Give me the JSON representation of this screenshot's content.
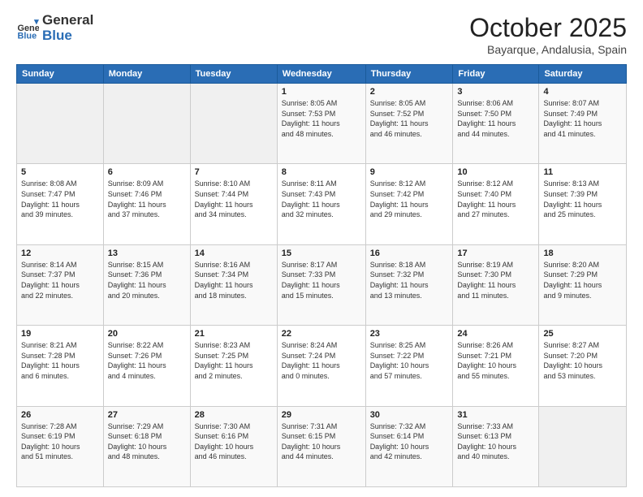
{
  "header": {
    "logo_general": "General",
    "logo_blue": "Blue",
    "month_title": "October 2025",
    "location": "Bayarque, Andalusia, Spain"
  },
  "calendar": {
    "days_of_week": [
      "Sunday",
      "Monday",
      "Tuesday",
      "Wednesday",
      "Thursday",
      "Friday",
      "Saturday"
    ],
    "weeks": [
      [
        {
          "day": "",
          "info": ""
        },
        {
          "day": "",
          "info": ""
        },
        {
          "day": "",
          "info": ""
        },
        {
          "day": "1",
          "info": "Sunrise: 8:05 AM\nSunset: 7:53 PM\nDaylight: 11 hours\nand 48 minutes."
        },
        {
          "day": "2",
          "info": "Sunrise: 8:05 AM\nSunset: 7:52 PM\nDaylight: 11 hours\nand 46 minutes."
        },
        {
          "day": "3",
          "info": "Sunrise: 8:06 AM\nSunset: 7:50 PM\nDaylight: 11 hours\nand 44 minutes."
        },
        {
          "day": "4",
          "info": "Sunrise: 8:07 AM\nSunset: 7:49 PM\nDaylight: 11 hours\nand 41 minutes."
        }
      ],
      [
        {
          "day": "5",
          "info": "Sunrise: 8:08 AM\nSunset: 7:47 PM\nDaylight: 11 hours\nand 39 minutes."
        },
        {
          "day": "6",
          "info": "Sunrise: 8:09 AM\nSunset: 7:46 PM\nDaylight: 11 hours\nand 37 minutes."
        },
        {
          "day": "7",
          "info": "Sunrise: 8:10 AM\nSunset: 7:44 PM\nDaylight: 11 hours\nand 34 minutes."
        },
        {
          "day": "8",
          "info": "Sunrise: 8:11 AM\nSunset: 7:43 PM\nDaylight: 11 hours\nand 32 minutes."
        },
        {
          "day": "9",
          "info": "Sunrise: 8:12 AM\nSunset: 7:42 PM\nDaylight: 11 hours\nand 29 minutes."
        },
        {
          "day": "10",
          "info": "Sunrise: 8:12 AM\nSunset: 7:40 PM\nDaylight: 11 hours\nand 27 minutes."
        },
        {
          "day": "11",
          "info": "Sunrise: 8:13 AM\nSunset: 7:39 PM\nDaylight: 11 hours\nand 25 minutes."
        }
      ],
      [
        {
          "day": "12",
          "info": "Sunrise: 8:14 AM\nSunset: 7:37 PM\nDaylight: 11 hours\nand 22 minutes."
        },
        {
          "day": "13",
          "info": "Sunrise: 8:15 AM\nSunset: 7:36 PM\nDaylight: 11 hours\nand 20 minutes."
        },
        {
          "day": "14",
          "info": "Sunrise: 8:16 AM\nSunset: 7:34 PM\nDaylight: 11 hours\nand 18 minutes."
        },
        {
          "day": "15",
          "info": "Sunrise: 8:17 AM\nSunset: 7:33 PM\nDaylight: 11 hours\nand 15 minutes."
        },
        {
          "day": "16",
          "info": "Sunrise: 8:18 AM\nSunset: 7:32 PM\nDaylight: 11 hours\nand 13 minutes."
        },
        {
          "day": "17",
          "info": "Sunrise: 8:19 AM\nSunset: 7:30 PM\nDaylight: 11 hours\nand 11 minutes."
        },
        {
          "day": "18",
          "info": "Sunrise: 8:20 AM\nSunset: 7:29 PM\nDaylight: 11 hours\nand 9 minutes."
        }
      ],
      [
        {
          "day": "19",
          "info": "Sunrise: 8:21 AM\nSunset: 7:28 PM\nDaylight: 11 hours\nand 6 minutes."
        },
        {
          "day": "20",
          "info": "Sunrise: 8:22 AM\nSunset: 7:26 PM\nDaylight: 11 hours\nand 4 minutes."
        },
        {
          "day": "21",
          "info": "Sunrise: 8:23 AM\nSunset: 7:25 PM\nDaylight: 11 hours\nand 2 minutes."
        },
        {
          "day": "22",
          "info": "Sunrise: 8:24 AM\nSunset: 7:24 PM\nDaylight: 11 hours\nand 0 minutes."
        },
        {
          "day": "23",
          "info": "Sunrise: 8:25 AM\nSunset: 7:22 PM\nDaylight: 10 hours\nand 57 minutes."
        },
        {
          "day": "24",
          "info": "Sunrise: 8:26 AM\nSunset: 7:21 PM\nDaylight: 10 hours\nand 55 minutes."
        },
        {
          "day": "25",
          "info": "Sunrise: 8:27 AM\nSunset: 7:20 PM\nDaylight: 10 hours\nand 53 minutes."
        }
      ],
      [
        {
          "day": "26",
          "info": "Sunrise: 7:28 AM\nSunset: 6:19 PM\nDaylight: 10 hours\nand 51 minutes."
        },
        {
          "day": "27",
          "info": "Sunrise: 7:29 AM\nSunset: 6:18 PM\nDaylight: 10 hours\nand 48 minutes."
        },
        {
          "day": "28",
          "info": "Sunrise: 7:30 AM\nSunset: 6:16 PM\nDaylight: 10 hours\nand 46 minutes."
        },
        {
          "day": "29",
          "info": "Sunrise: 7:31 AM\nSunset: 6:15 PM\nDaylight: 10 hours\nand 44 minutes."
        },
        {
          "day": "30",
          "info": "Sunrise: 7:32 AM\nSunset: 6:14 PM\nDaylight: 10 hours\nand 42 minutes."
        },
        {
          "day": "31",
          "info": "Sunrise: 7:33 AM\nSunset: 6:13 PM\nDaylight: 10 hours\nand 40 minutes."
        },
        {
          "day": "",
          "info": ""
        }
      ]
    ]
  }
}
